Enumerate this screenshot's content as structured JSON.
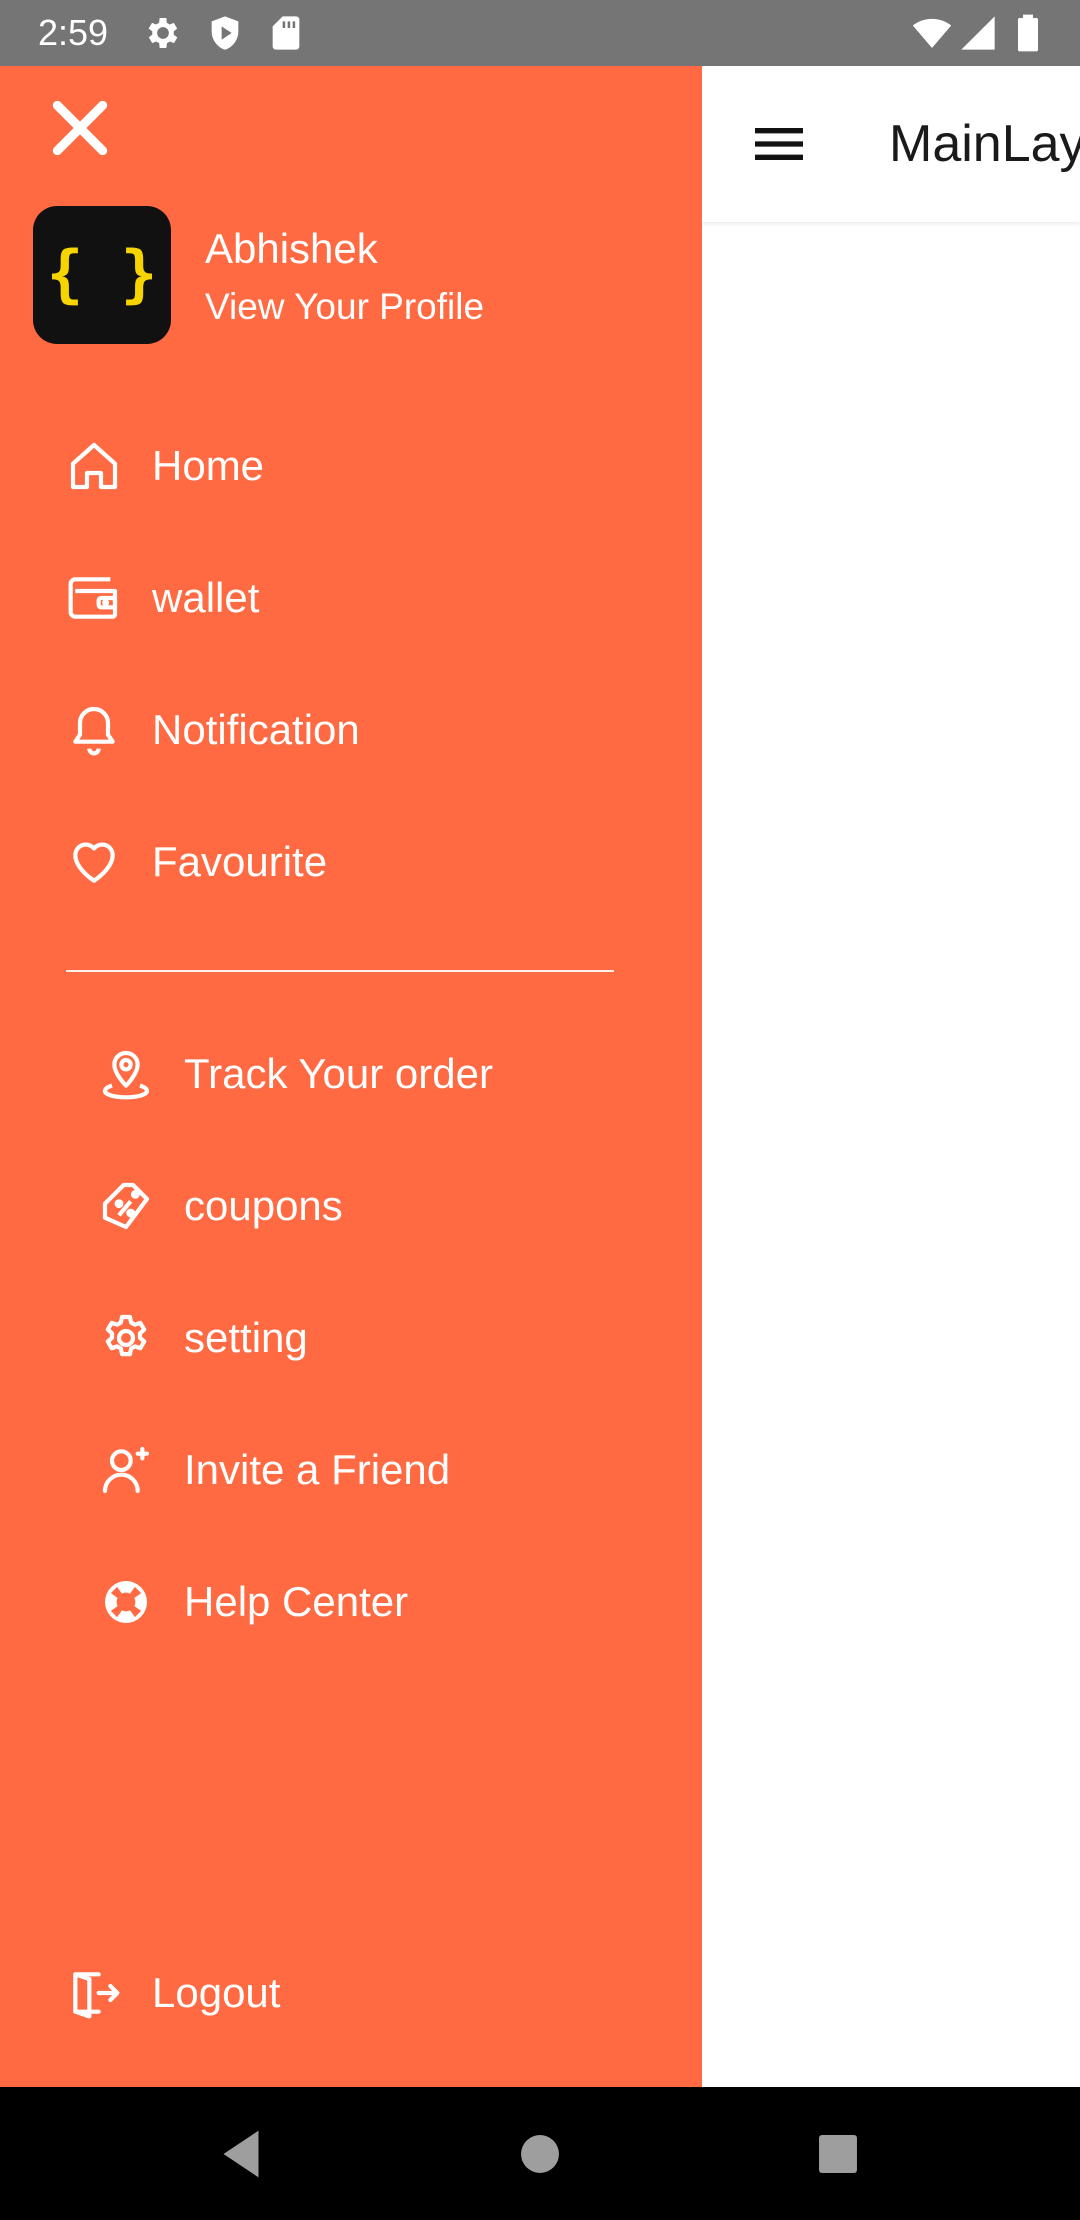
{
  "status_bar": {
    "time": "2:59",
    "left_icons": [
      "gear-icon",
      "shield-play-icon",
      "sd-card-icon"
    ],
    "right_icons": [
      "wifi-icon",
      "cell-signal-icon",
      "battery-icon"
    ]
  },
  "app_bar": {
    "title": "MainLay",
    "menu_icon": "hamburger-icon"
  },
  "drawer": {
    "background": "#ff6a42",
    "close_icon": "close-icon",
    "profile": {
      "avatar_icon": "curly-braces-logo-icon",
      "name": "Abhishek",
      "link": "View Your Profile"
    },
    "primary_items": [
      {
        "label": "Home",
        "icon": "home-icon"
      },
      {
        "label": "wallet",
        "icon": "wallet-icon"
      },
      {
        "label": "Notification",
        "icon": "bell-icon"
      },
      {
        "label": "Favourite",
        "icon": "heart-icon"
      }
    ],
    "secondary_items": [
      {
        "label": "Track Your order",
        "icon": "location-pin-icon"
      },
      {
        "label": "coupons",
        "icon": "coupon-tag-icon"
      },
      {
        "label": "setting",
        "icon": "settings-gear-icon"
      },
      {
        "label": "Invite a Friend",
        "icon": "user-plus-icon"
      },
      {
        "label": "Help Center",
        "icon": "lifebuoy-icon"
      }
    ],
    "logout": {
      "label": "Logout",
      "icon": "logout-icon"
    }
  },
  "nav_bar": {
    "buttons": [
      "back-icon",
      "home-circle-icon",
      "recents-square-icon"
    ]
  }
}
